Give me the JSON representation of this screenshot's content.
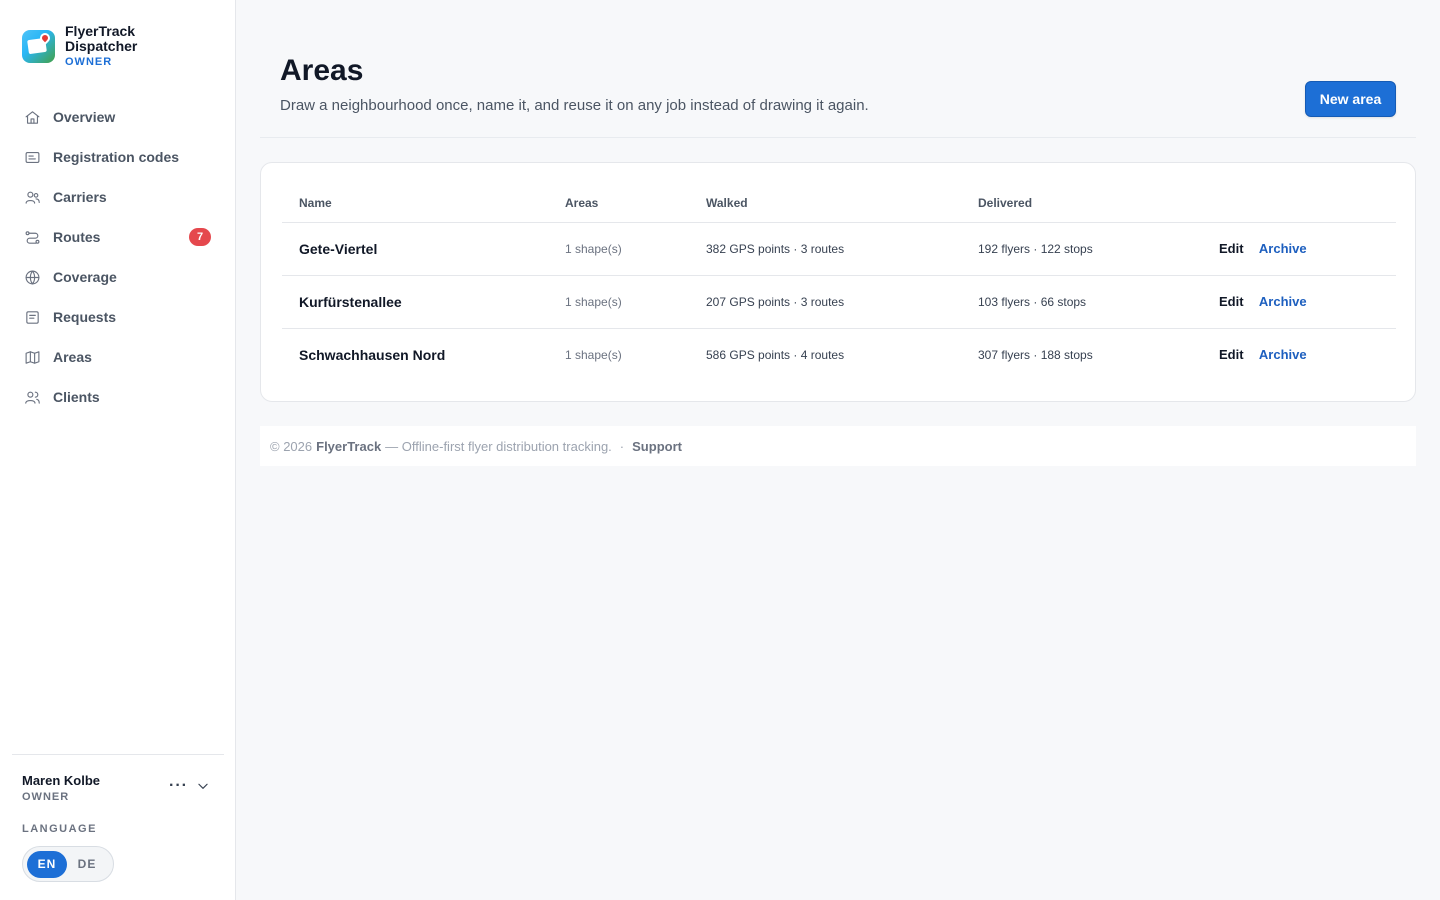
{
  "brand": {
    "name": "FlyerTrack Dispatcher",
    "role": "OWNER"
  },
  "nav": [
    {
      "label": "Overview",
      "icon": "home-icon"
    },
    {
      "label": "Registration codes",
      "icon": "id-card-icon"
    },
    {
      "label": "Carriers",
      "icon": "users-icon"
    },
    {
      "label": "Routes",
      "icon": "route-icon",
      "badge": "7"
    },
    {
      "label": "Coverage",
      "icon": "globe-icon"
    },
    {
      "label": "Requests",
      "icon": "document-icon"
    },
    {
      "label": "Areas",
      "icon": "map-icon"
    },
    {
      "label": "Clients",
      "icon": "clients-icon"
    }
  ],
  "user": {
    "name": "Maren Kolbe",
    "role": "OWNER",
    "menu": "···"
  },
  "language": {
    "label": "LANGUAGE",
    "options": [
      "EN",
      "DE"
    ],
    "active": "EN"
  },
  "page": {
    "title": "Areas",
    "description": "Draw a neighbourhood once, name it, and reuse it on any job instead of drawing it again.",
    "new_button": "New area"
  },
  "table": {
    "columns": [
      "Name",
      "Areas",
      "Walked",
      "Delivered"
    ],
    "rows": [
      {
        "name": "Gete-Viertel",
        "areas": "1 shape(s)",
        "walked": "382 GPS points · 3 routes",
        "delivered": "192 flyers · 122 stops",
        "edit": "Edit",
        "archive": "Archive"
      },
      {
        "name": "Kurfürstenallee",
        "areas": "1 shape(s)",
        "walked": "207 GPS points · 3 routes",
        "delivered": "103 flyers · 66 stops",
        "edit": "Edit",
        "archive": "Archive"
      },
      {
        "name": "Schwachhausen Nord",
        "areas": "1 shape(s)",
        "walked": "586 GPS points · 4 routes",
        "delivered": "307 flyers · 188 stops",
        "edit": "Edit",
        "archive": "Archive"
      }
    ]
  },
  "footer": {
    "copyright": "© 2026",
    "brand": "FlyerTrack",
    "tagline": "— Offline-first flyer distribution tracking.",
    "separator": "·",
    "support": "Support"
  },
  "colors": {
    "accent": "#1d6fd6",
    "badge": "#e5484d",
    "background": "#f7f8fa"
  }
}
